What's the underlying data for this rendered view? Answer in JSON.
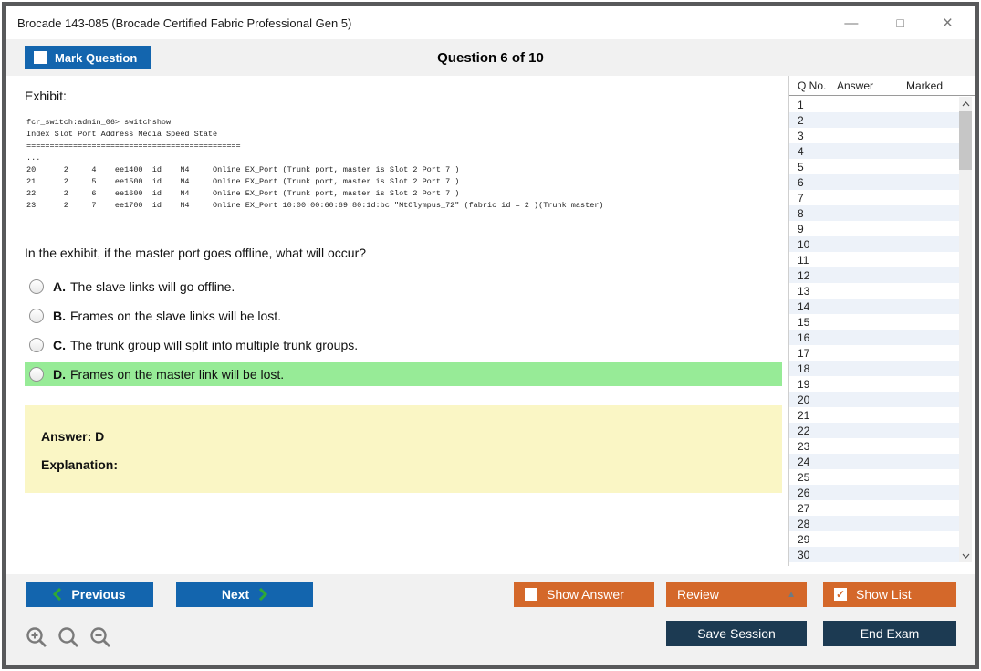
{
  "window": {
    "title": "Brocade 143-085 (Brocade Certified Fabric Professional Gen 5)",
    "controls": {
      "minimize": "—",
      "maximize": "□",
      "close": "×"
    }
  },
  "header": {
    "mark_question_label": "Mark Question",
    "question_counter": "Question 6 of 10"
  },
  "exhibit": {
    "label": "Exhibit:",
    "code_lines": [
      "fcr_switch:admin_06> switchshow",
      "Index Slot Port Address Media Speed State",
      "==============================================",
      "...",
      "20      2     4    ee1400  id    N4     Online EX_Port (Trunk port, master is Slot 2 Port 7 )",
      "21      2     5    ee1500  id    N4     Online EX_Port (Trunk port, master is Slot 2 Port 7 )",
      "22      2     6    ee1600  id    N4     Online EX_Port (Trunk port, master is Slot 2 Port 7 )",
      "23      2     7    ee1700  id    N4     Online EX_Port 10:00:00:60:69:80:1d:bc \"MtOlympus_72\" (fabric id = 2 )(Trunk master)"
    ]
  },
  "question": {
    "text": "In the exhibit, if the master port goes offline, what will occur?",
    "options": [
      {
        "letter": "A.",
        "text": "The slave links will go offline.",
        "highlighted": false
      },
      {
        "letter": "B.",
        "text": "Frames on the slave links will be lost.",
        "highlighted": false
      },
      {
        "letter": "C.",
        "text": "The trunk group will split into multiple trunk groups.",
        "highlighted": false
      },
      {
        "letter": "D.",
        "text": "Frames on the master link will be lost.",
        "highlighted": true
      }
    ]
  },
  "answer_panel": {
    "answer_label": "Answer: D",
    "explanation_label": "Explanation:"
  },
  "question_list": {
    "headers": [
      "Q No.",
      "Answer",
      "Marked"
    ],
    "rows": [
      "1",
      "2",
      "3",
      "4",
      "5",
      "6",
      "7",
      "8",
      "9",
      "10",
      "11",
      "12",
      "13",
      "14",
      "15",
      "16",
      "17",
      "18",
      "19",
      "20",
      "21",
      "22",
      "23",
      "24",
      "25",
      "26",
      "27",
      "28",
      "29",
      "30"
    ]
  },
  "footer": {
    "previous_label": "Previous",
    "next_label": "Next",
    "show_answer_label": "Show Answer",
    "review_label": "Review",
    "show_list_label": "Show List",
    "save_session_label": "Save Session",
    "end_exam_label": "End Exam"
  },
  "colors": {
    "accent_blue": "#1365AE",
    "accent_orange": "#D4682A",
    "dark_navy": "#1C3A52",
    "highlight_green": "#97EB97",
    "answer_bg": "#FAF6C5",
    "alt_row": "#EDF2F9",
    "chevron_green": "#2EA836"
  }
}
